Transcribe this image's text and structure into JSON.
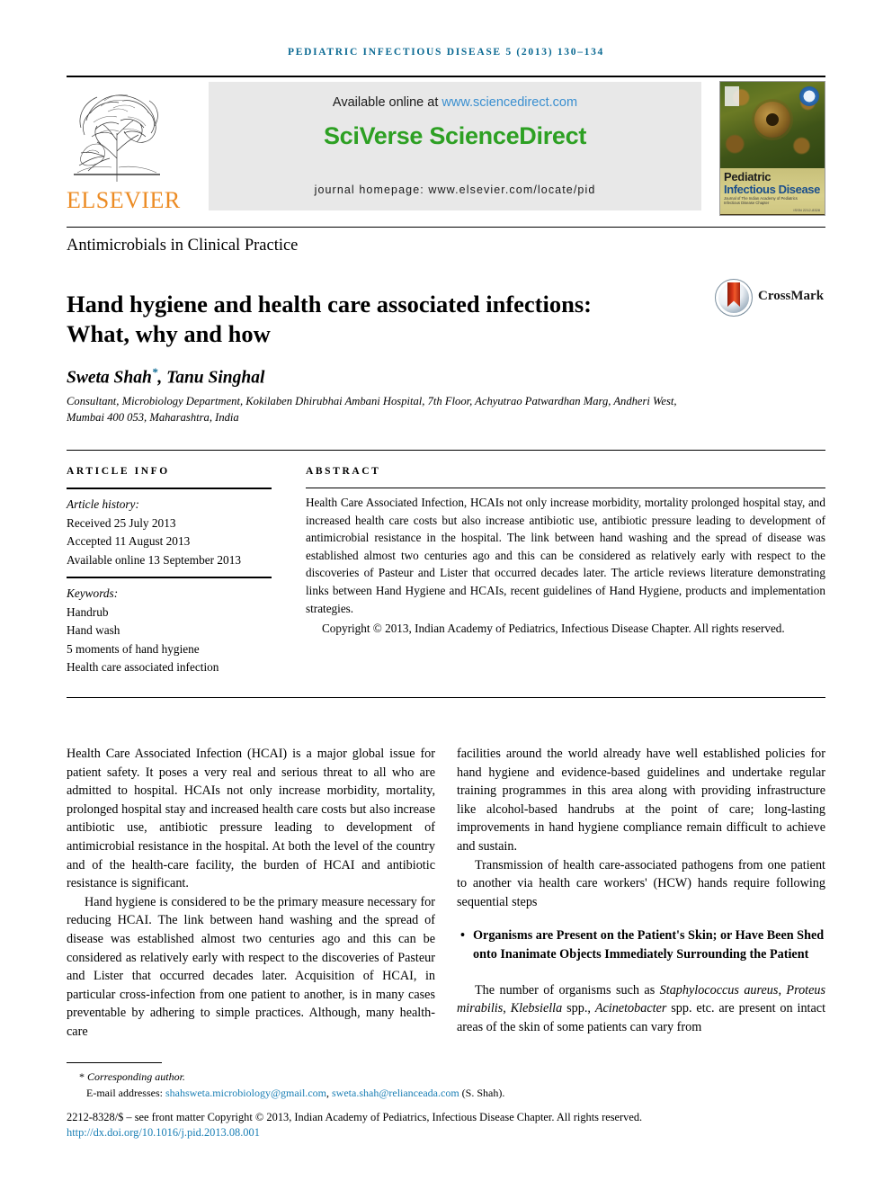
{
  "running_head": "Pediatric Infectious Disease 5 (2013) 130–134",
  "masthead": {
    "publisher_name": "ELSEVIER",
    "available_online_prefix": "Available online at",
    "sciencedirect_url": "www.sciencedirect.com",
    "platform_logo": "SciVerse ScienceDirect",
    "journal_homepage": "journal homepage: www.elsevier.com/locate/pid",
    "cover": {
      "title_line1": "Pediatric",
      "title_line2": "Infectious Disease",
      "subtitle": "Journal of The Indian Academy of Pediatrics Infectious Disease Chapter",
      "issn": "ISSN 2212-8328"
    }
  },
  "section_head": "Antimicrobials in Clinical Practice",
  "title": "Hand hygiene and health care associated infections: What, why and how",
  "crossmark_label": "CrossMark",
  "authors": {
    "names": "Sweta Shah, Tanu Singhal",
    "name_first": "Sweta Shah",
    "name_rest": ", Tanu Singhal",
    "corresponding_marker": "*",
    "affiliation": "Consultant, Microbiology Department, Kokilaben Dhirubhai Ambani Hospital, 7th Floor, Achyutrao Patwardhan Marg, Andheri West, Mumbai 400 053, Maharashtra, India"
  },
  "article_info": {
    "heading": "ARTICLE INFO",
    "history_label": "Article history:",
    "history": [
      "Received 25 July 2013",
      "Accepted 11 August 2013",
      "Available online 13 September 2013"
    ],
    "keywords_label": "Keywords:",
    "keywords": [
      "Handrub",
      "Hand wash",
      "5 moments of hand hygiene",
      "Health care associated infection"
    ]
  },
  "abstract": {
    "heading": "ABSTRACT",
    "body": "Health Care Associated Infection, HCAIs not only increase morbidity, mortality prolonged hospital stay, and increased health care costs but also increase antibiotic use, antibiotic pressure leading to development of antimicrobial resistance in the hospital. The link between hand washing and the spread of disease was established almost two centuries ago and this can be considered as relatively early with respect to the discoveries of Pasteur and Lister that occurred decades later. The article reviews literature demonstrating links between Hand Hygiene and HCAIs, recent guidelines of Hand Hygiene, products and implementation strategies.",
    "copyright": "Copyright © 2013, Indian Academy of Pediatrics, Infectious Disease Chapter. All rights reserved."
  },
  "body": {
    "left_para_1": "Health Care Associated Infection (HCAI) is a major global issue for patient safety. It poses a very real and serious threat to all who are admitted to hospital. HCAIs not only increase morbidity, mortality, prolonged hospital stay and increased health care costs but also increase antibiotic use, antibiotic pressure leading to development of antimicrobial resistance in the hospital. At both the level of the country and of the health-care facility, the burden of HCAI and antibiotic resistance is significant.",
    "left_para_2": "Hand hygiene is considered to be the primary measure necessary for reducing HCAI. The link between hand washing and the spread of disease was established almost two centuries ago and this can be considered as relatively early with respect to the discoveries of Pasteur and Lister that occurred decades later. Acquisition of HCAI, in particular cross-infection from one patient to another, is in many cases preventable by adhering to simple practices. Although, many health-care",
    "right_para_1": "facilities around the world already have well established policies for hand hygiene and evidence-based guidelines and undertake regular training programmes in this area along with providing infrastructure like alcohol-based handrubs at the point of care; long-lasting improvements in hand hygiene compliance remain difficult to achieve and sustain.",
    "right_para_2": "Transmission of health care-associated pathogens from one patient to another via health care workers' (HCW) hands require following sequential steps",
    "bullet_1": "Organisms are Present on the Patient's Skin; or Have Been Shed onto Inanimate Objects Immediately Surrounding the Patient",
    "right_para_3_a": "The number of organisms such as ",
    "right_para_3_i1": "Staphylococcus aureus",
    "right_para_3_b": ", ",
    "right_para_3_i2": "Proteus mirabilis",
    "right_para_3_c": ", ",
    "right_para_3_i3": "Klebsiella",
    "right_para_3_d": " spp., ",
    "right_para_3_i4": "Acinetobacter",
    "right_para_3_e": " spp. etc. are present on intact areas of the skin of some patients can vary from"
  },
  "footer": {
    "corresponding_marker": "*",
    "corresponding_text": "Corresponding author.",
    "email_label": "E-mail addresses:",
    "email_1": "shahsweta.microbiology@gmail.com",
    "email_2": "sweta.shah@relianceada.com",
    "email_attribution": "(S. Shah).",
    "copyright_line": "2212-8328/$ – see front matter Copyright © 2013, Indian Academy of Pediatrics, Infectious Disease Chapter. All rights reserved.",
    "doi": "http://dx.doi.org/10.1016/j.pid.2013.08.001"
  },
  "colors": {
    "running_head": "#0c6a93",
    "elsevier_orange": "#ec8b23",
    "sciencedirect_green": "#2da023",
    "link_blue": "#3a8fd0",
    "footer_link": "#1a7fb5"
  }
}
